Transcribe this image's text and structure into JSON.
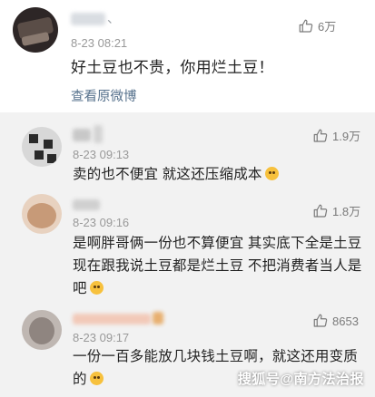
{
  "post": {
    "name_suffix": "、",
    "time": "8-23 08:21",
    "likes": "6万",
    "text": "好土豆也不贵，你用烂土豆！",
    "view_original": "查看原微博"
  },
  "replies": [
    {
      "time": "8-23 09:13",
      "likes": "1.9万",
      "lines": [
        "卖的也不便宜 就这还压缩成本"
      ],
      "emoji": "grinning-emoji"
    },
    {
      "time": "8-23 09:16",
      "likes": "1.8万",
      "lines": [
        "是啊胖哥俩一份也不算便宜 其实底下全是土豆",
        "现在跟我说土豆都是烂土豆 不把消费者当人是",
        "吧"
      ],
      "emoji": "pleading-emoji"
    },
    {
      "time": "8-23 09:17",
      "likes": "8653",
      "lines": [
        "一份一百多能放几块钱土豆啊，就这还用变质",
        "的"
      ],
      "emoji": "vomit-emoji"
    }
  ],
  "watermark": "搜狐号@南方法治报",
  "icons": {
    "like": "thumbs-up-icon"
  }
}
